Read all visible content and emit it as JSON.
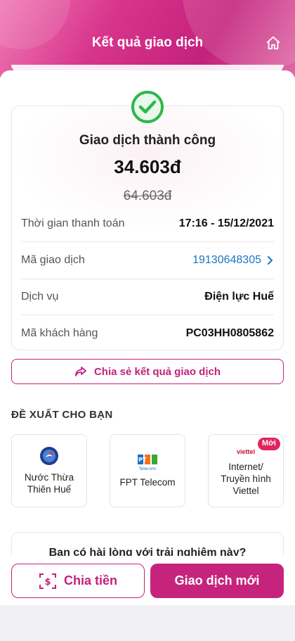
{
  "header": {
    "title": "Kết quả giao dịch"
  },
  "result": {
    "status": "Giao dịch thành công",
    "amount": "34.603đ",
    "original_amount": "64.603đ"
  },
  "details": [
    {
      "label": "Thời gian thanh toán",
      "value": "17:16 - 15/12/2021"
    },
    {
      "label": "Mã giao dịch",
      "value": "19130648305"
    },
    {
      "label": "Dịch vụ",
      "value": "Điện lực Huế"
    },
    {
      "label": "Mã khách hàng",
      "value": "PC03HH0805862"
    }
  ],
  "share": {
    "label": "Chia sẻ kết quả giao dịch"
  },
  "suggestions": {
    "title": "ĐỀ XUẤT CHO BẠN",
    "items": [
      {
        "label": "Nước Thừa\nThiên Huế"
      },
      {
        "label": "FPT Telecom",
        "logo_text": "FPT",
        "logo_sub": "Telecom"
      },
      {
        "label": "Internet/\nTruyền hình\nViettel",
        "logo_text": "viettel",
        "badge": "Mới"
      }
    ]
  },
  "survey": {
    "question": "Bạn có hài lòng với trải nghiệm này?"
  },
  "actions": {
    "split": "Chia tiền",
    "new_transaction": "Giao dịch mới"
  },
  "colors": {
    "brand": "#c3217b",
    "success": "#2db84b",
    "link": "#1a76c2"
  }
}
